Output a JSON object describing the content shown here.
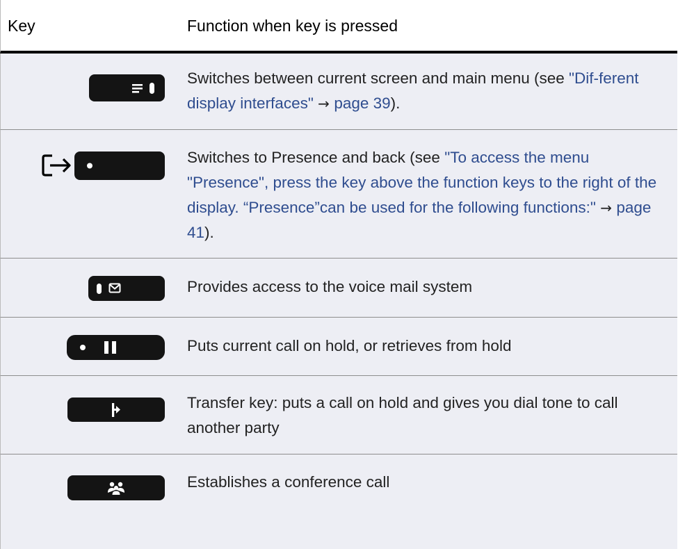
{
  "header": {
    "key_label": "Key",
    "function_label": "Function when key is pressed"
  },
  "rows": [
    {
      "key_icon": "menu-toggle-icon",
      "pre": "Switches between current screen and main menu (see ",
      "link": "\"Dif-ferent display interfaces\"",
      "arrow": " → ",
      "page_link": "page 39",
      "post": ")."
    },
    {
      "key_icon": "presence-logout-icon",
      "pre": "Switches to Presence and back (see ",
      "link": "\"To access the menu \"Presence\", press the key above the function keys to the right of the display. “Presence”can be used for the following functions:\"",
      "arrow": " → ",
      "page_link": "page 41",
      "post": ")."
    },
    {
      "key_icon": "voicemail-icon",
      "text": "Provides access to the voice mail system"
    },
    {
      "key_icon": "hold-pause-icon",
      "text": "Puts current call on hold, or retrieves from hold"
    },
    {
      "key_icon": "transfer-icon",
      "text": "Transfer key: puts a call on hold and gives you dial tone to call another party"
    },
    {
      "key_icon": "conference-icon",
      "text": "Establishes a conference call"
    }
  ]
}
